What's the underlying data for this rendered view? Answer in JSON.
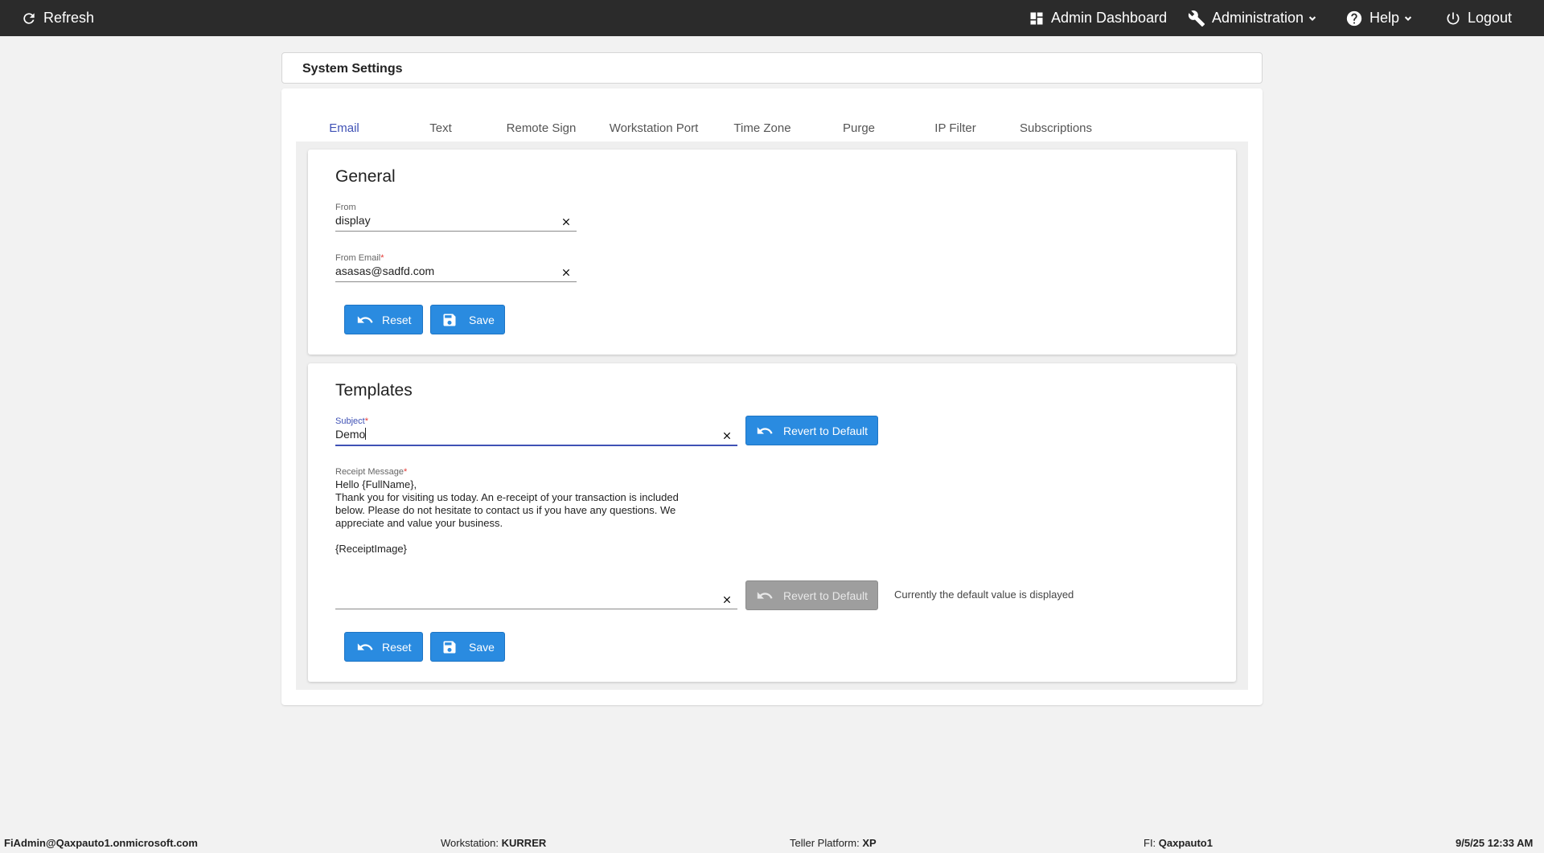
{
  "topbar": {
    "refresh_label": "Refresh",
    "admin_dashboard_label": "Admin Dashboard",
    "administration_label": "Administration",
    "help_label": "Help",
    "logout_label": "Logout"
  },
  "page": {
    "title": "System Settings"
  },
  "tabs": [
    {
      "label": "Email",
      "active": true
    },
    {
      "label": "Text"
    },
    {
      "label": "Remote Sign"
    },
    {
      "label": "Workstation Port"
    },
    {
      "label": "Time Zone"
    },
    {
      "label": "Purge"
    },
    {
      "label": "IP Filter"
    },
    {
      "label": "Subscriptions"
    }
  ],
  "general": {
    "title": "General",
    "from": {
      "label": "From",
      "value": "display"
    },
    "from_email": {
      "label": "From Email",
      "required_mark": "*",
      "value": "asasas@sadfd.com"
    },
    "reset_label": "Reset",
    "save_label": "Save"
  },
  "templates": {
    "title": "Templates",
    "subject": {
      "label": "Subject",
      "required_mark": "*",
      "value": "Demo"
    },
    "revert_label": "Revert to Default",
    "receipt": {
      "label": "Receipt Message",
      "required_mark": "*",
      "value": "Hello {FullName},\nThank you for visiting us today. An e-receipt of your transaction is included\nbelow. Please do not hesitate to contact us if you have any questions. We\nappreciate and value your business.\n\n{ReceiptImage}"
    },
    "revert_disabled_label": "Revert to Default",
    "default_note": "Currently the default value is displayed",
    "reset_label": "Reset",
    "save_label": "Save"
  },
  "footer": {
    "user": "FiAdmin@Qaxpauto1.onmicrosoft.com",
    "workstation_label": "Workstation:",
    "workstation_value": "KURRER",
    "teller_platform_label": "Teller Platform:",
    "teller_platform_value": "XP",
    "fi_label": "FI:",
    "fi_value": "Qaxpauto1",
    "datetime": "9/5/25 12:33 AM"
  },
  "colors": {
    "topbar_bg": "#2b2b2b",
    "accent": "#3f51b5",
    "button_primary": "#2a8be0",
    "button_disabled": "#9e9e9e",
    "required": "#e53935"
  }
}
